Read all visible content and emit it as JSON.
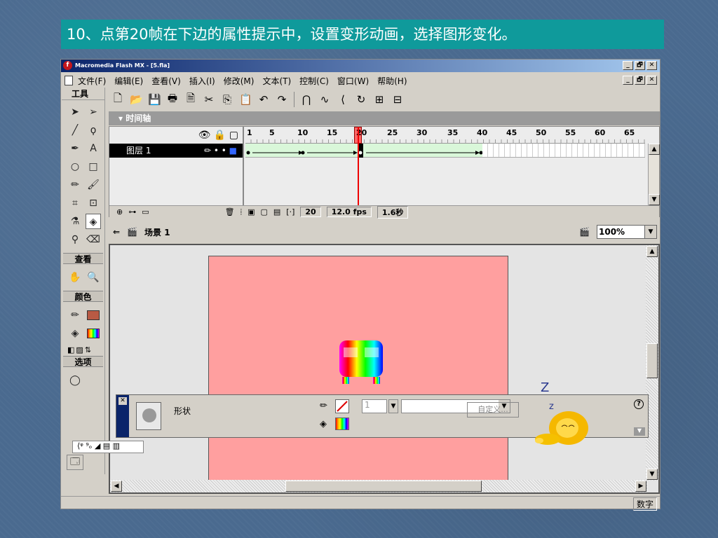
{
  "slide_title": "10、点第20帧在下边的属性提示中，设置变形动画，选择图形变化。",
  "app": {
    "title": "Macromedia Flash MX - [5.fla]",
    "menu": [
      "文件(F)",
      "编辑(E)",
      "查看(V)",
      "插入(I)",
      "修改(M)",
      "文本(T)",
      "控制(C)",
      "窗口(W)",
      "帮助(H)"
    ],
    "window_buttons": [
      "_",
      "🗗",
      "✕"
    ]
  },
  "tools_panel": {
    "title": "工具",
    "view_section": "查看",
    "color_section": "颜色",
    "options_section": "选项"
  },
  "timeline": {
    "title": "▾ 时间轴",
    "layer_name": "图层 1",
    "ruler_numbers": [
      "1",
      "5",
      "10",
      "15",
      "20",
      "25",
      "30",
      "35",
      "40",
      "45",
      "50",
      "55",
      "60",
      "65"
    ],
    "current_frame": "20",
    "fps": "12.0 fps",
    "time": "1.6秒"
  },
  "scene": {
    "name": "场景 1",
    "zoom": "100%"
  },
  "properties": {
    "type_label": "形状",
    "stroke_width": "1",
    "custom_button": "自定义..."
  },
  "statusbar": {
    "indicator": "数字"
  },
  "decoration": {
    "sleep_z_big": "Z",
    "sleep_z_small": "z"
  },
  "colors": {
    "slide_title_bg": "#0f9a9b",
    "canvas_bg": "#ff9f9f",
    "fill_swatch": "#b85a44"
  }
}
